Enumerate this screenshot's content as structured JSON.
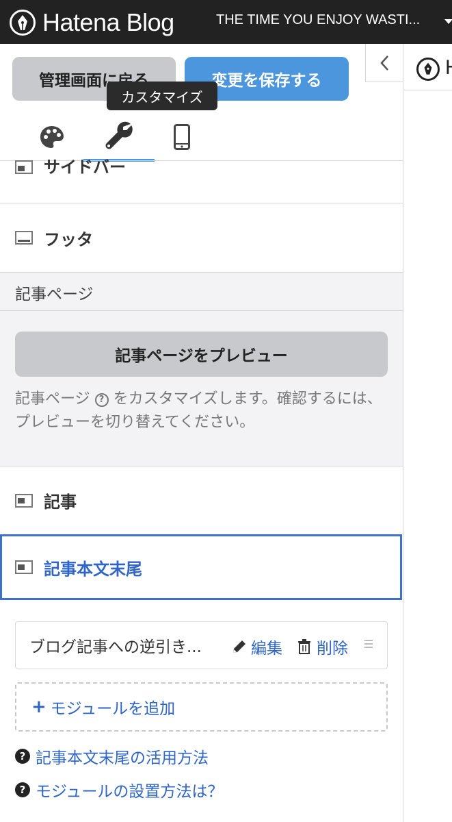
{
  "header": {
    "brand": "Hatena Blog",
    "blog_title": "THE TIME YOU ENJOY WASTI..."
  },
  "sidebar": {
    "back_button": "管理画面に戻る",
    "save_button": "変更を保存する",
    "tooltip": "カスタマイズ",
    "tabs": [
      {
        "icon": "palette-icon"
      },
      {
        "icon": "wrench-icon",
        "active": true
      },
      {
        "icon": "mobile-icon"
      }
    ],
    "sections_top": [
      {
        "label": "サイドバー",
        "icon": "layout-sidebar-icon"
      },
      {
        "label": "フッタ",
        "icon": "layout-footer-icon"
      }
    ],
    "article_page": {
      "heading": "記事ページ",
      "preview_button": "記事ページをプレビュー",
      "desc_part1": "記事ページ",
      "help_mark": "?",
      "desc_part2": "をカスタマイズします。確認するには、プレビューを切り替えてください。"
    },
    "sections_article": [
      {
        "label": "記事",
        "icon": "layout-article-icon"
      },
      {
        "label": "記事本文末尾",
        "icon": "layout-article-footer-icon",
        "active": true
      }
    ],
    "module": {
      "name": "ブログ記事への逆引き...",
      "edit": "編集",
      "delete": "削除"
    },
    "add_module": "モジュールを追加",
    "help_links": [
      "記事本文末尾の活用方法",
      "モジュールの設置方法は？"
    ]
  },
  "preview": {
    "letter": "H"
  },
  "colors": {
    "accent": "#4b96dc",
    "link": "#2f66c5",
    "header_bg": "#222222"
  }
}
